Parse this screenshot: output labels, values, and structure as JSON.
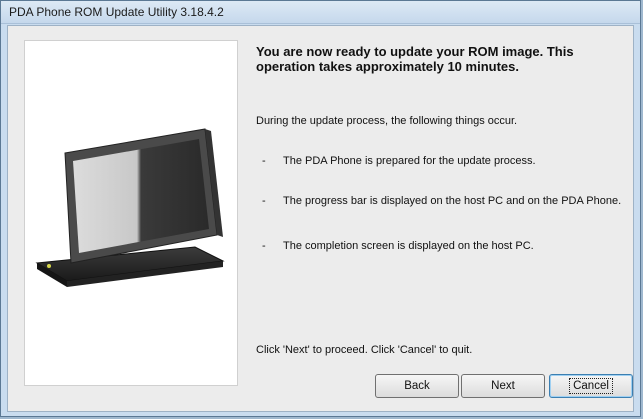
{
  "window": {
    "title": "PDA Phone ROM Update Utility 3.18.4.2"
  },
  "content": {
    "heading": "You are now ready to update your ROM image. This operation takes approximately 10 minutes.",
    "intro": "During the update process, the following things occur.",
    "bullets": [
      {
        "dash": "-",
        "text": "The PDA Phone is prepared for the update process."
      },
      {
        "dash": "-",
        "text": "The progress bar is displayed on the host PC and on the PDA Phone."
      },
      {
        "dash": "-",
        "text": "The completion screen is displayed on the host PC."
      }
    ],
    "footer": "Click 'Next' to proceed. Click 'Cancel' to quit."
  },
  "buttons": {
    "back": "Back",
    "next": "Next",
    "cancel": "Cancel"
  },
  "colors": {
    "title_bar": "#c5d8ec",
    "dialog_bg": "#ececec",
    "default_button_border": "#3c7fb1"
  }
}
